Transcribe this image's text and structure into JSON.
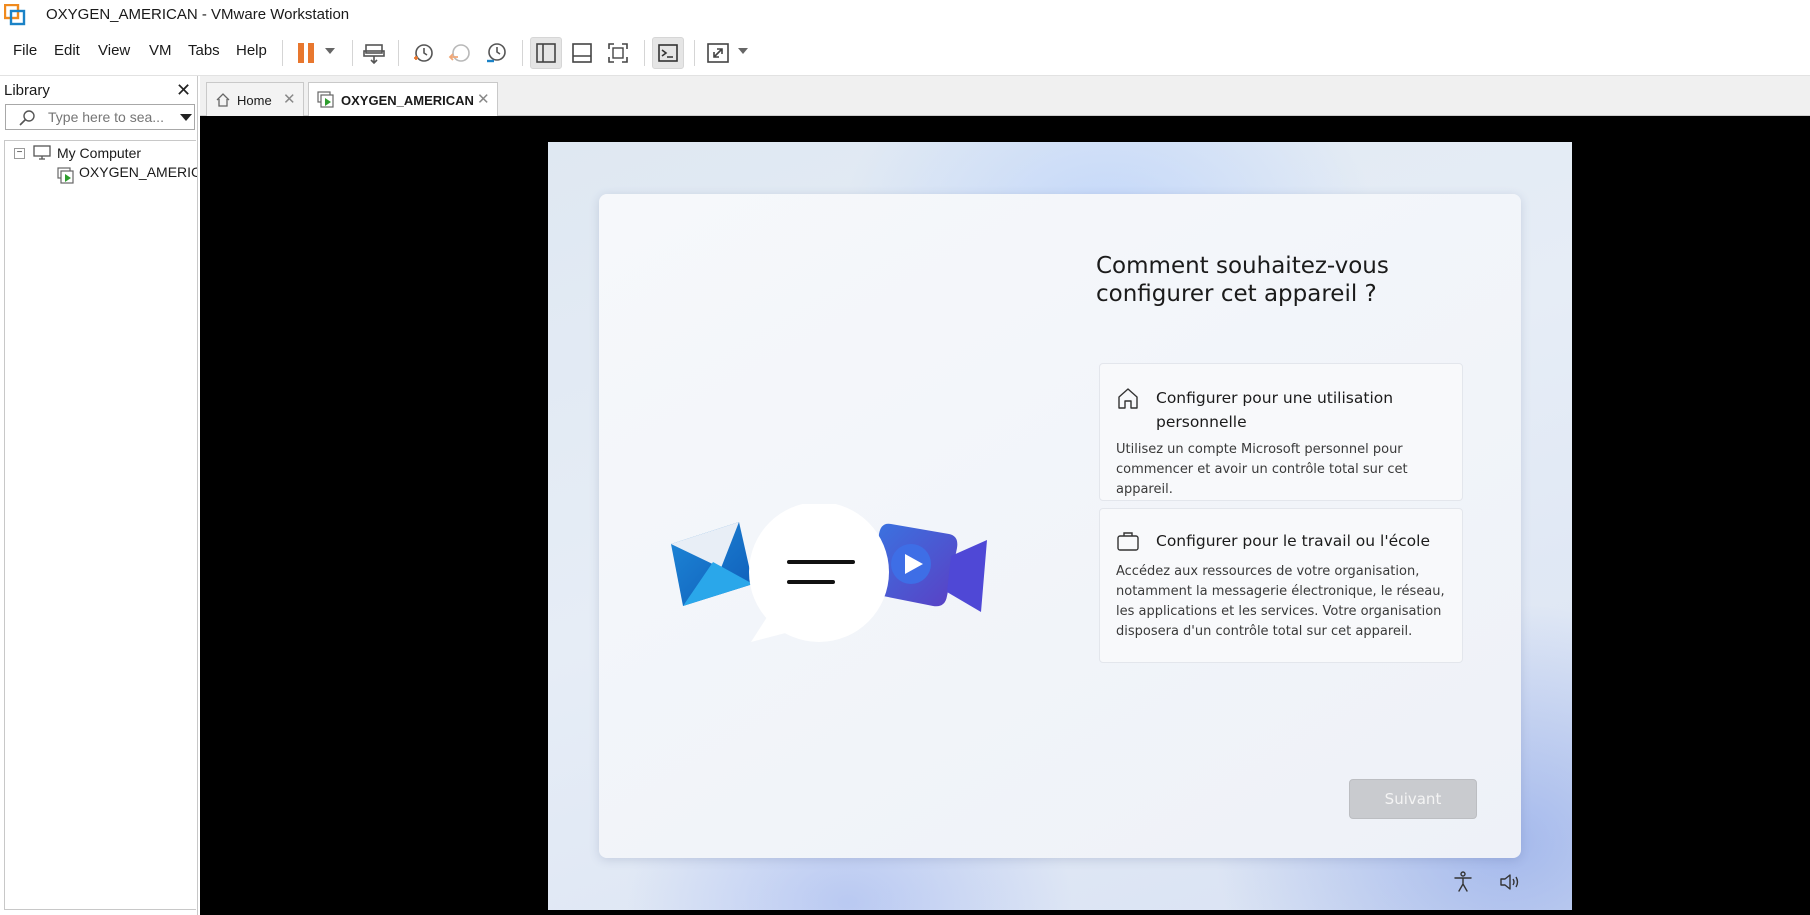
{
  "window": {
    "title": "OXYGEN_AMERICAN - VMware Workstation"
  },
  "menu": {
    "items": [
      "File",
      "Edit",
      "View",
      "VM",
      "Tabs",
      "Help"
    ]
  },
  "toolbar": {
    "icons": [
      "pause-icon",
      "send-ctrl-alt-del-icon",
      "snapshot-icon",
      "revert-snapshot-icon",
      "snapshot-manager-icon",
      "show-library-icon",
      "thumbnail-bar-icon",
      "full-screen-icon",
      "console-view-icon",
      "stretch-guest-icon"
    ],
    "accent": "#e8772e"
  },
  "library": {
    "title": "Library",
    "search_placeholder": "Type here to sea...",
    "tree": {
      "root": "My Computer",
      "vm": "OXYGEN_AMERIC"
    }
  },
  "tabs": [
    {
      "label": "Home",
      "active": false
    },
    {
      "label": "OXYGEN_AMERICAN",
      "active": true
    }
  ],
  "guest": {
    "title": "Comment souhaitez-vous configurer cet appareil ?",
    "options": [
      {
        "title": "Configurer pour une utilisation personnelle",
        "description": "Utilisez un compte Microsoft personnel pour commencer et avoir un contrôle total sur cet appareil.",
        "icon": "home-icon"
      },
      {
        "title": "Configurer pour le travail ou l'école",
        "description": "Accédez aux ressources de votre organisation, notamment la messagerie électronique, le réseau, les applications et les services. Votre organisation disposera d'un contrôle total sur cet appareil.",
        "icon": "briefcase-icon"
      }
    ],
    "next_label": "Suivant",
    "bottom_icons": [
      "accessibility-icon",
      "volume-icon"
    ]
  }
}
